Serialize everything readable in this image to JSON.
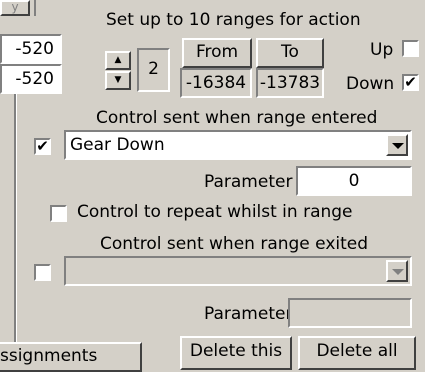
{
  "left_panel": {
    "tab_fragment": "y",
    "values": [
      "-520",
      "-520"
    ],
    "button_fragment": "ssignments"
  },
  "ranges": {
    "heading": "Set up to 10 ranges for action",
    "count": "2",
    "from_label": "From",
    "to_label": "To",
    "from_value": "-16384",
    "to_value": "-13783",
    "up_label": "Up",
    "up_checked": false,
    "down_label": "Down",
    "down_checked": true,
    "check_mark": "✔"
  },
  "entered": {
    "heading": "Control sent when range entered",
    "checked": true,
    "selected_control": "Gear Down",
    "parameter_label": "Parameter",
    "parameter_value": "0"
  },
  "repeat": {
    "label": "Control to repeat whilst in range",
    "checked": false
  },
  "exited": {
    "heading": "Control sent when range exited",
    "checked": false,
    "selected_control": "",
    "parameter_label": "Parameter",
    "parameter_value": ""
  },
  "actions": {
    "delete_this": "Delete this",
    "delete_all": "Delete all"
  }
}
